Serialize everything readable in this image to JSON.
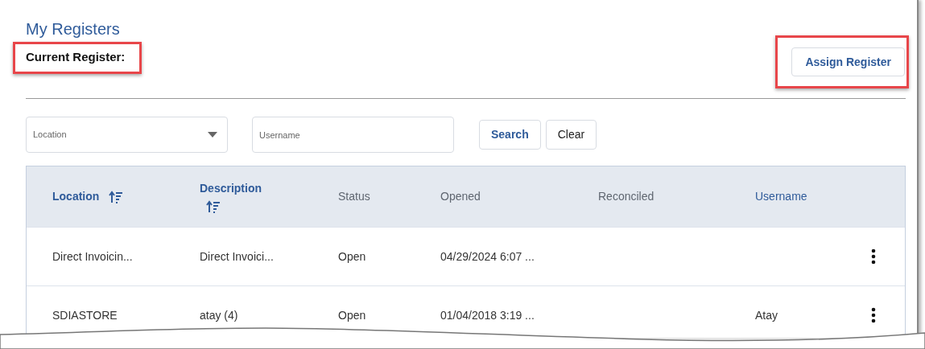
{
  "title": "My Registers",
  "current_register": {
    "label": "Current Register:",
    "highlighted": true
  },
  "assign_button": {
    "label": "Assign Register",
    "highlighted": true
  },
  "filters": {
    "location": {
      "placeholder": "Location"
    },
    "username": {
      "placeholder": "Username"
    },
    "buttons": [
      {
        "label": "Search",
        "kind": "primary"
      },
      {
        "label": "Clear",
        "kind": "plain"
      }
    ]
  },
  "table": {
    "columns": [
      {
        "label": "Location",
        "kind": "sorted"
      },
      {
        "label": "Description",
        "kind": "sorted"
      },
      {
        "label": "Status",
        "kind": "plain"
      },
      {
        "label": "Opened",
        "kind": "plain"
      },
      {
        "label": "Reconciled",
        "kind": "plain"
      },
      {
        "label": "Username",
        "kind": "sortable"
      }
    ],
    "rows": [
      {
        "cells": [
          "Direct Invoicin...",
          "Direct Invoici...",
          "Open",
          "04/29/2024 6:07 ...",
          "",
          ""
        ]
      },
      {
        "cells": [
          "SDIASTORE",
          "atay (4)",
          "Open",
          "01/04/2018 3:19 ...",
          "",
          "Atay"
        ]
      }
    ]
  }
}
